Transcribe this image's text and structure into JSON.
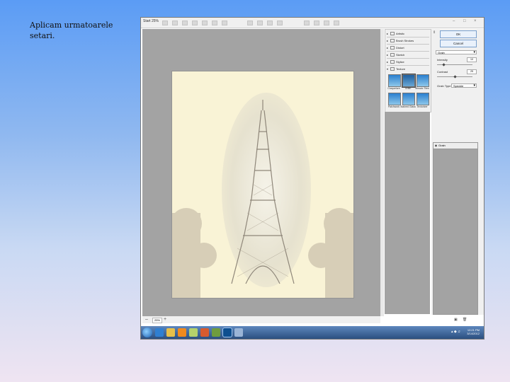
{
  "slide": {
    "caption": "Aplicam urmatoarele setari."
  },
  "window": {
    "title": "Start 25%"
  },
  "filter_gallery": {
    "folders": [
      "Artistic",
      "Brush Strokes",
      "Distort",
      "Sketch",
      "Stylize",
      "Texture"
    ],
    "texture_thumbs": [
      "Craquelure",
      "Grain",
      "Mosaic Tiles",
      "Patchwork",
      "Stained Glass",
      "Texturizer"
    ],
    "selected_thumb": "Grain",
    "ok_label": "OK",
    "cancel_label": "Cancel",
    "filter_select": "Grain",
    "params": [
      {
        "label": "Intensity",
        "value": "10"
      },
      {
        "label": "Contrast",
        "value": "25"
      }
    ],
    "grain_type_label": "Grain Type",
    "grain_type_value": "Speckle",
    "layer_label": "Grain"
  },
  "status": {
    "zoom": "25%"
  },
  "taskbar": {
    "time": "12:21 PM",
    "date": "3/14/2012"
  },
  "colors": {
    "thumb": "#2a7fcf",
    "canvas_bg": "#a3a3a3",
    "paper": "#f9f3d6"
  }
}
